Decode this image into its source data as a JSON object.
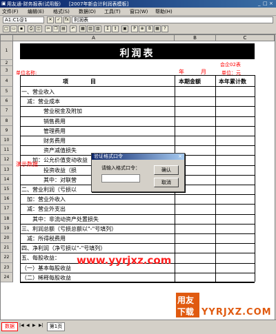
{
  "window": {
    "app_title": "用友通-财务报表(试用版)",
    "doc_title": "[2007年新会计利润表模板]"
  },
  "menu": [
    "文件(F)",
    "编辑(E)",
    "格式(S)",
    "数据(D)",
    "工具(T)",
    "窗口(W)",
    "帮助(H)"
  ],
  "formula_bar": {
    "cell_ref": "A1:C1@1",
    "content": "利润表"
  },
  "columns": [
    "A",
    "B",
    "C"
  ],
  "report": {
    "title": "利润表",
    "form_no": "会企02表",
    "unit_label": "单位名称:",
    "year": "年",
    "month": "月",
    "currency_unit": "单位：元",
    "header_item": "项　　　　目",
    "header_current": "本期金额",
    "header_cumulative": "本年累计数"
  },
  "rows": [
    {
      "n": "1",
      "text": ""
    },
    {
      "n": "2",
      "text": ""
    },
    {
      "n": "3",
      "text": ""
    },
    {
      "n": "4",
      "text": ""
    },
    {
      "n": "5",
      "text": "一、营业收入"
    },
    {
      "n": "6",
      "text": "　减：营业成本"
    },
    {
      "n": "7",
      "text": "　　　　营业税金及附加"
    },
    {
      "n": "8",
      "text": "　　　　销售费用"
    },
    {
      "n": "9",
      "text": "　　　　管理费用"
    },
    {
      "n": "10",
      "text": "　　　　财务费用"
    },
    {
      "n": "11",
      "text": "　　　　资产减值损失"
    },
    {
      "n": "12",
      "text": "　　加：公允价值变动收益（损失以\"-\"填列）"
    },
    {
      "n": "13",
      "text": "　　　　投资收益（损"
    },
    {
      "n": "14",
      "text": "　　　　其中：对联营"
    },
    {
      "n": "15",
      "text": "二、营业利润（亏损以"
    },
    {
      "n": "16",
      "text": "　加：营业外收入"
    },
    {
      "n": "17",
      "text": "　减：营业外支出"
    },
    {
      "n": "18",
      "text": "　　其中：非流动资产处置损失"
    },
    {
      "n": "19",
      "text": "三、利润总额（亏损总额以\"-\"号填列）"
    },
    {
      "n": "20",
      "text": "　减：所得税费用"
    },
    {
      "n": "21",
      "text": "四、净利润（净亏损以\"-\"号填列）"
    },
    {
      "n": "22",
      "text": "五、每股收益："
    },
    {
      "n": "23",
      "text": "（一）基本每股收益"
    },
    {
      "n": "24",
      "text": "（二）稀释每股收益"
    }
  ],
  "demo_label": "演示数据",
  "dialog": {
    "title": "验证格式口令",
    "prompt": "请输入格式口令：",
    "ok": "确认",
    "cancel": "取消"
  },
  "watermark": "www.yyrjxz.com",
  "logo_text_1": "用友",
  "logo_text_2": "下载",
  "logo_domain": "YYRJXZ.COM",
  "status": {
    "mode": "数据",
    "sheet_tab": "第1页"
  },
  "colors": {
    "accent_red": "#ff0000",
    "title_bg": "#000000",
    "titlebar": "#0a246a"
  }
}
